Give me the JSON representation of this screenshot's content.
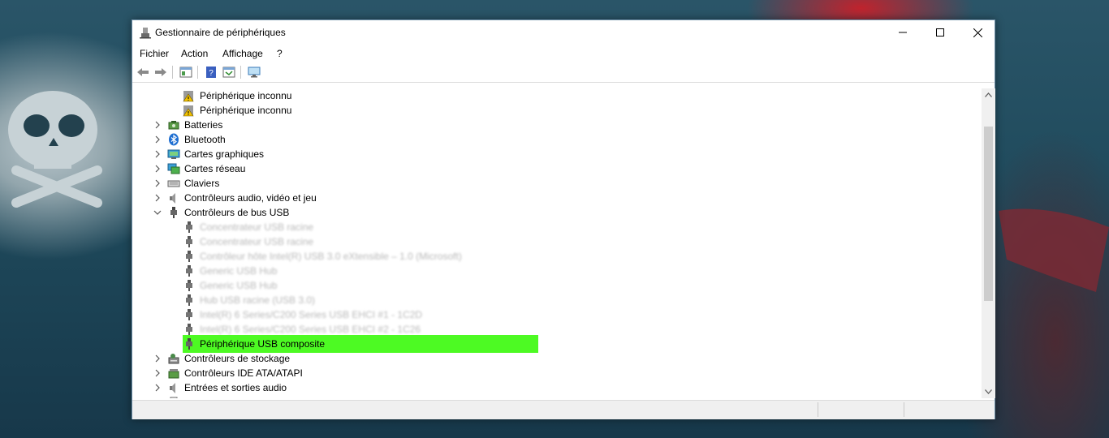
{
  "window": {
    "title": "Gestionnaire de périphériques"
  },
  "menu": [
    "Fichier",
    "Action",
    "Affichage",
    "?"
  ],
  "toolbar_icons": [
    "back-icon",
    "forward-icon",
    "properties-icon",
    "help-icon",
    "update-driver-icon",
    "scan-hardware-icon"
  ],
  "tree": [
    {
      "label": "Périphérique inconnu",
      "level": 2,
      "icon": "warning-device-icon"
    },
    {
      "label": "Périphérique inconnu",
      "level": 2,
      "icon": "warning-device-icon"
    },
    {
      "label": "Batteries",
      "level": 1,
      "icon": "battery-icon",
      "expander": "collapsed"
    },
    {
      "label": "Bluetooth",
      "level": 1,
      "icon": "bluetooth-icon",
      "expander": "collapsed"
    },
    {
      "label": "Cartes graphiques",
      "level": 1,
      "icon": "display-adapter-icon",
      "expander": "collapsed"
    },
    {
      "label": "Cartes réseau",
      "level": 1,
      "icon": "network-adapter-icon",
      "expander": "collapsed"
    },
    {
      "label": "Claviers",
      "level": 1,
      "icon": "keyboard-icon",
      "expander": "collapsed"
    },
    {
      "label": "Contrôleurs audio, vidéo et jeu",
      "level": 1,
      "icon": "speaker-icon",
      "expander": "collapsed"
    },
    {
      "label": "Contrôleurs de bus USB",
      "level": 1,
      "icon": "usb-icon",
      "expander": "expanded"
    },
    {
      "label": "Concentrateur USB racine",
      "level": 2,
      "icon": "usb-icon",
      "dim": true
    },
    {
      "label": "Concentrateur USB racine",
      "level": 2,
      "icon": "usb-icon",
      "dim": true
    },
    {
      "label": "Contrôleur hôte Intel(R) USB 3.0 eXtensible – 1.0 (Microsoft)",
      "level": 2,
      "icon": "usb-icon",
      "dim": true
    },
    {
      "label": "Generic USB Hub",
      "level": 2,
      "icon": "usb-icon",
      "dim": true
    },
    {
      "label": "Generic USB Hub",
      "level": 2,
      "icon": "usb-icon",
      "dim": true
    },
    {
      "label": "Hub USB racine (USB 3.0)",
      "level": 2,
      "icon": "usb-icon",
      "dim": true
    },
    {
      "label": "Intel(R) 6 Series/C200 Series USB EHCI #1 - 1C2D",
      "level": 2,
      "icon": "usb-icon",
      "dim": true
    },
    {
      "label": "Intel(R) 6 Series/C200 Series USB EHCI #2 - 1C26",
      "level": 2,
      "icon": "usb-icon",
      "dim": true
    },
    {
      "label": "Périphérique USB composite",
      "level": 2,
      "icon": "usb-icon",
      "selected": true
    },
    {
      "label": "Contrôleurs de stockage",
      "level": 1,
      "icon": "storage-icon",
      "expander": "collapsed"
    },
    {
      "label": "Contrôleurs IDE ATA/ATAPI",
      "level": 1,
      "icon": "ide-controller-icon",
      "expander": "collapsed"
    },
    {
      "label": "Entrées et sorties audio",
      "level": 1,
      "icon": "speaker-icon",
      "expander": "collapsed"
    },
    {
      "label": "Files d'attente d'impression",
      "level": 1,
      "icon": "printer-icon",
      "expander": "collapsed"
    }
  ],
  "colors": {
    "selection": "#4dfa23",
    "dim_text": "#b8b8b8"
  }
}
